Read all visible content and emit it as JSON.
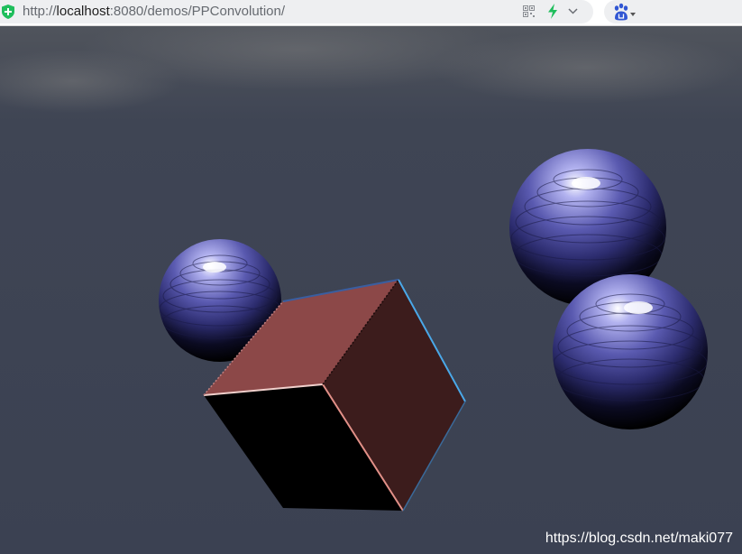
{
  "address_bar": {
    "url_prefix": "http://",
    "url_host": "localhost",
    "url_rest": ":8080/demos/PPConvolution/"
  },
  "icons": {
    "security": "shield-plus-icon",
    "qr": "qr-code-icon",
    "speed": "lightning-bolt-icon",
    "dropdown": "chevron-down-icon",
    "search_engine": "paw-icon"
  },
  "scene": {
    "background_color": "#3c4252",
    "sphere_color": "#4a4a9c",
    "cube_top_color": "#8c4848",
    "cube_right_color": "#3c1c1c",
    "cube_front_color": "#000000",
    "watermark": "https://blog.csdn.net/maki077"
  }
}
